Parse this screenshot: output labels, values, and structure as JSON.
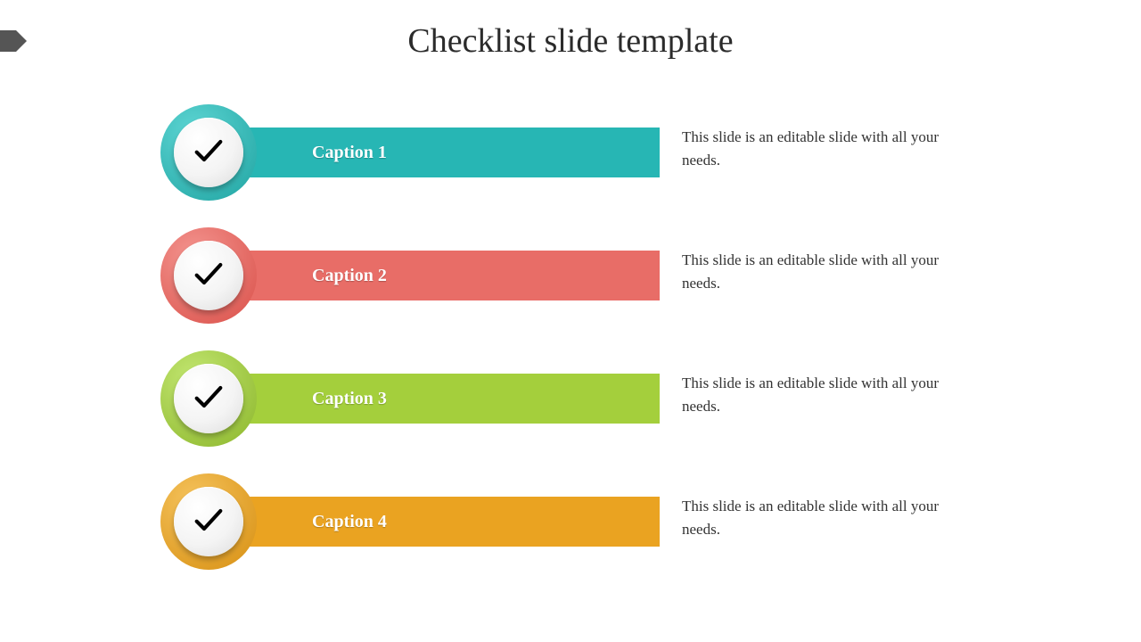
{
  "title": "Checklist slide template",
  "items": [
    {
      "caption": "Caption 1",
      "description": "This slide is an editable slide with all your needs.",
      "color": "#27b6b4"
    },
    {
      "caption": "Caption 2",
      "description": "This slide is an editable slide with all your needs.",
      "color": "#e86d67"
    },
    {
      "caption": "Caption 3",
      "description": "This slide is an editable slide with all your needs.",
      "color": "#a4cf3c"
    },
    {
      "caption": "Caption 4",
      "description": "This slide is an editable slide with all your needs.",
      "color": "#eaa321"
    }
  ]
}
